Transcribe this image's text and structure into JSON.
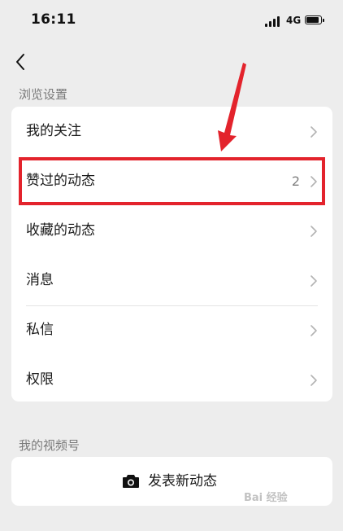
{
  "status_bar": {
    "time": "16:11",
    "network": "4G"
  },
  "nav": {
    "back_icon": "chevron-left-icon"
  },
  "browse_settings": {
    "section_title": "浏览设置",
    "items": [
      {
        "label": "我的关注",
        "count": ""
      },
      {
        "label": "赞过的动态",
        "count": "2"
      },
      {
        "label": "收藏的动态",
        "count": ""
      },
      {
        "label": "消息",
        "count": ""
      },
      {
        "label": "私信",
        "count": ""
      },
      {
        "label": "权限",
        "count": ""
      }
    ]
  },
  "channels": {
    "section_title": "我的视频号",
    "post_button_label": "发表新动态",
    "post_button_icon": "camera-icon"
  },
  "annotation": {
    "highlight_color": "#e3232c"
  },
  "watermark": {
    "text": "Bai 经验"
  }
}
